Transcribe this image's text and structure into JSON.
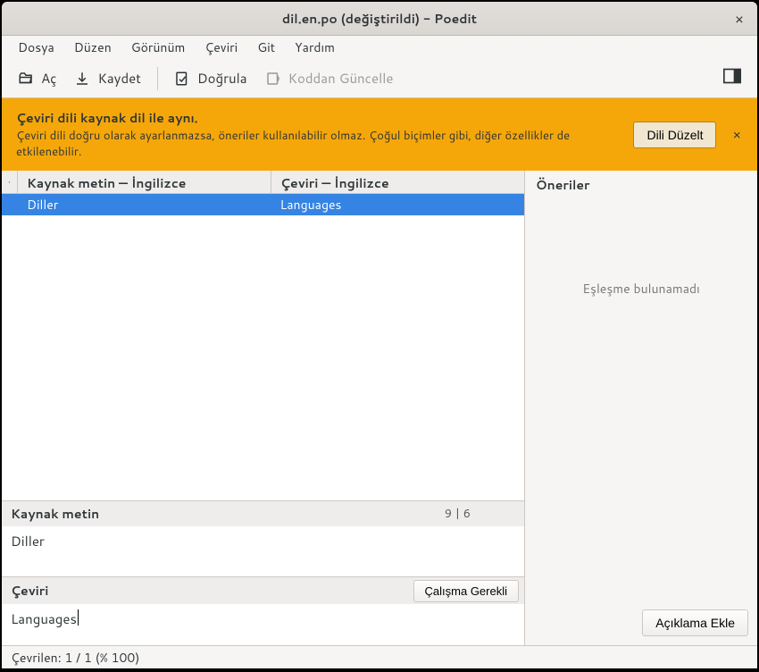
{
  "titlebar": {
    "title": "dil.en.po (değiştirildi) - Poedit"
  },
  "menu": {
    "file": "Dosya",
    "edit": "Düzen",
    "view": "Görünüm",
    "translate": "Çeviri",
    "go": "Git",
    "help": "Yardım"
  },
  "toolbar": {
    "open": "Aç",
    "save": "Kaydet",
    "validate": "Doğrula",
    "update_from_code": "Koddan Güncelle"
  },
  "warning": {
    "title": "Çeviri dili kaynak dil ile aynı.",
    "desc": "Çeviri dili doğru olarak ayarlanmazsa, öneriler kullanılabilir olmaz. Çoğul biçimler gibi, diğer özellikler de etkilenebilir.",
    "fix_button": "Dili Düzelt"
  },
  "columns": {
    "source": "Kaynak metin — İngilizce",
    "translation": "Çeviri — İngilizce"
  },
  "rows": [
    {
      "source": "Diller",
      "translation": "Languages"
    }
  ],
  "source_panel": {
    "title": "Kaynak metin",
    "counter": "9 | 6",
    "text": "Diller"
  },
  "translation_panel": {
    "title": "Çeviri",
    "needs_work": "Çalışma Gerekli",
    "text": "Languages"
  },
  "sidebar": {
    "title": "Öneriler",
    "empty": "Eşleşme bulunamadı",
    "add_note": "Açıklama Ekle"
  },
  "statusbar": {
    "text": "Çevrilen: 1 / 1 (% 100)"
  }
}
